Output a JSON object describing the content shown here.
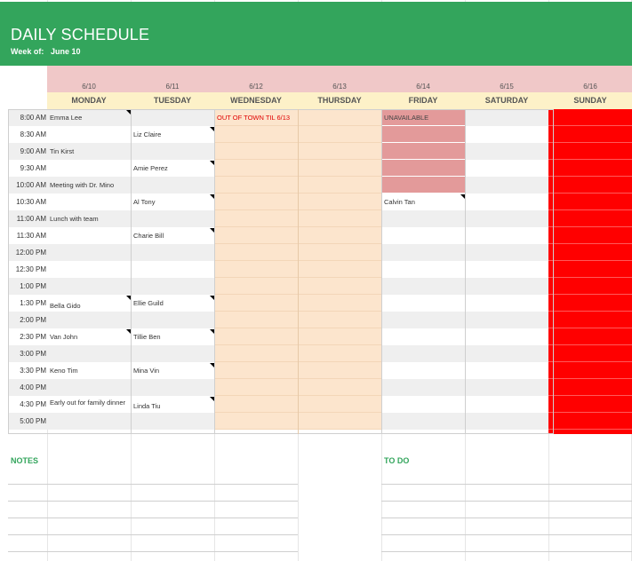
{
  "header": {
    "title": "DAILY SCHEDULE",
    "week_label": "Week of:",
    "week_value": "June 10",
    "band_color": "#33a55c"
  },
  "columns": [
    {
      "date": "6/10",
      "day": "MONDAY"
    },
    {
      "date": "6/11",
      "day": "TUESDAY"
    },
    {
      "date": "6/12",
      "day": "WEDNESDAY"
    },
    {
      "date": "6/13",
      "day": "THURSDAY"
    },
    {
      "date": "6/14",
      "day": "FRIDAY"
    },
    {
      "date": "6/15",
      "day": "SATURDAY"
    },
    {
      "date": "6/16",
      "day": "SUNDAY"
    }
  ],
  "times": [
    "8:00 AM",
    "8:30 AM",
    "9:00 AM",
    "9:30 AM",
    "10:00 AM",
    "10:30 AM",
    "11:00 AM",
    "11:30 AM",
    "12:00 PM",
    "12:30 PM",
    "1:00 PM",
    "1:30 PM",
    "2:00 PM",
    "2:30 PM",
    "3:00 PM",
    "3:30 PM",
    "4:00 PM",
    "4:30 PM",
    "5:00 PM"
  ],
  "entries": {
    "monday": {
      "r0": "Emma Lee",
      "r2": "Tin Kirst",
      "r4": "Meeting with Dr. Mino",
      "r6": "Lunch with team",
      "r11": "Bella Gido",
      "r13": "Van John",
      "r15": "Keno Tim",
      "r17": "Early out for family dinner"
    },
    "tuesday": {
      "r1": "Liz Claire",
      "r3": "Amie Perez",
      "r5": "Al Tony",
      "r7": "Charie Bill",
      "r11": "Ellie Guild",
      "r13": "Tillie Ben",
      "r15": "Mina Vin",
      "r17": "Linda Tiu"
    },
    "wednesday": {
      "r0": "OUT OF TOWN TIL 6/13"
    },
    "friday": {
      "r0": "UNAVAILABLE",
      "r5": "Calvin Tan"
    }
  },
  "colors": {
    "out_of_town_fill": "#fce5cd",
    "out_of_town_text": "#e00000",
    "unavailable_fill": "#e39a9a",
    "sunday_fill": "#ff0000",
    "date_row": "#f0c8c8",
    "day_row": "#fdf1c8"
  },
  "footer": {
    "notes_label": "NOTES",
    "todo_label": "TO DO"
  }
}
